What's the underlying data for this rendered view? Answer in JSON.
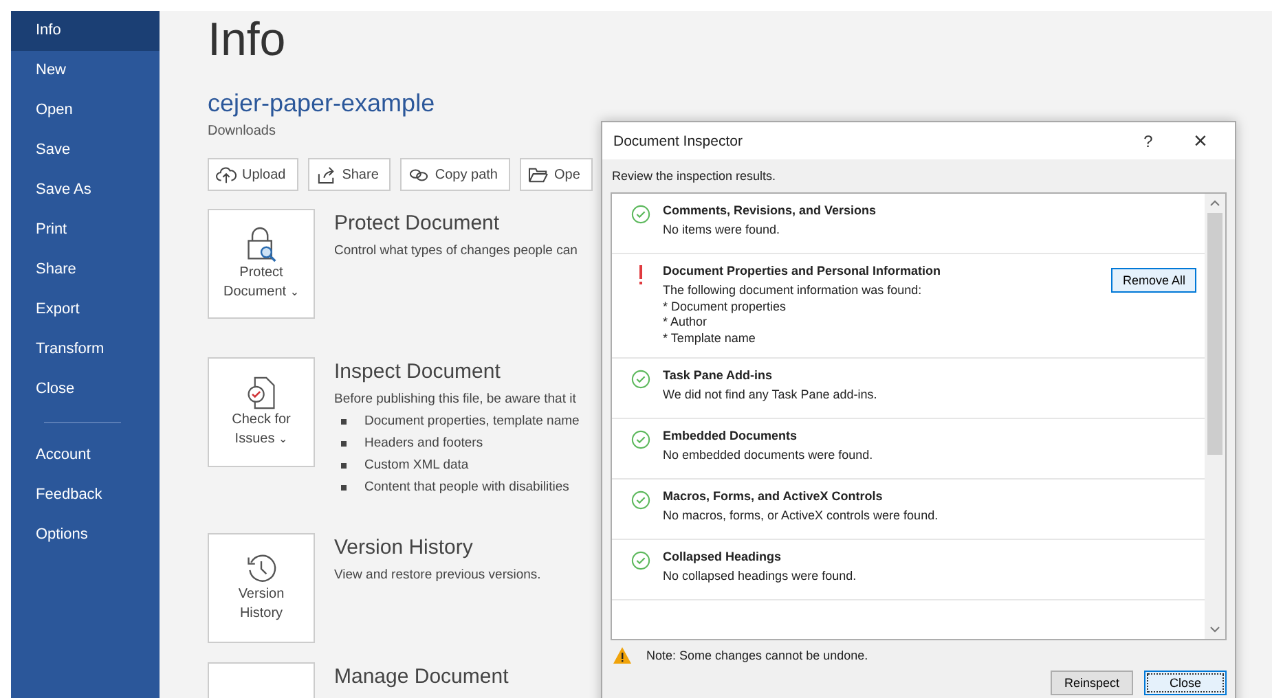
{
  "sidebar": {
    "items": [
      {
        "label": "Info",
        "selected": true
      },
      {
        "label": "New",
        "selected": false
      },
      {
        "label": "Open",
        "selected": false
      },
      {
        "label": "Save",
        "selected": false
      },
      {
        "label": "Save As",
        "selected": false
      },
      {
        "label": "Print",
        "selected": false
      },
      {
        "label": "Share",
        "selected": false
      },
      {
        "label": "Export",
        "selected": false
      },
      {
        "label": "Transform",
        "selected": false
      },
      {
        "label": "Close",
        "selected": false
      }
    ],
    "bottom_items": [
      {
        "label": "Account",
        "selected": false
      },
      {
        "label": "Feedback",
        "selected": false
      },
      {
        "label": "Options",
        "selected": false
      }
    ]
  },
  "page": {
    "title": "Info",
    "file_name": "cejer-paper-example",
    "location": "Downloads",
    "actions": [
      "Upload",
      "Share",
      "Copy path",
      "Ope"
    ],
    "sections": [
      {
        "kind": "protect",
        "button": [
          "Protect",
          "Document"
        ],
        "caret": "⌄",
        "title": "Protect Document",
        "description": "Control what types of changes people can"
      },
      {
        "kind": "inspect",
        "button": [
          "Check for",
          "Issues"
        ],
        "caret": "⌄",
        "title": "Inspect Document",
        "description": "Before publishing this file, be aware that it",
        "bullets": [
          "Document properties, template name",
          "Headers and footers",
          "Custom XML data",
          "Content that people with disabilities"
        ]
      },
      {
        "kind": "history",
        "button": [
          "Version",
          "History"
        ],
        "title": "Version History",
        "description": "View and restore previous versions."
      },
      {
        "kind": "manage",
        "title": "Manage Document"
      }
    ]
  },
  "dialog": {
    "title": "Document Inspector",
    "help": "?",
    "close": "×",
    "intro": "Review the inspection results.",
    "results": [
      {
        "kind": "ok",
        "title": "Comments, Revisions, and Versions",
        "lines": [
          "No items were found."
        ]
      },
      {
        "kind": "issue",
        "title": "Document Properties and Personal Information",
        "lines": [
          "The following document information was found:",
          "* Document properties",
          "* Author",
          "* Template name"
        ],
        "action": "Remove All"
      },
      {
        "kind": "ok",
        "title": "Task Pane Add-ins",
        "lines": [
          "We did not find any Task Pane add-ins."
        ]
      },
      {
        "kind": "ok",
        "title": "Embedded Documents",
        "lines": [
          "No embedded documents were found."
        ]
      },
      {
        "kind": "ok",
        "title": "Macros, Forms, and ActiveX Controls",
        "lines": [
          "No macros, forms, or ActiveX controls were found."
        ]
      },
      {
        "kind": "ok",
        "title": "Collapsed Headings",
        "lines": [
          "No collapsed headings were found."
        ]
      }
    ],
    "note": "Note: Some changes cannot be undone.",
    "buttons": [
      {
        "label": "Reinspect",
        "default": false
      },
      {
        "label": "Close",
        "default": true
      }
    ]
  }
}
